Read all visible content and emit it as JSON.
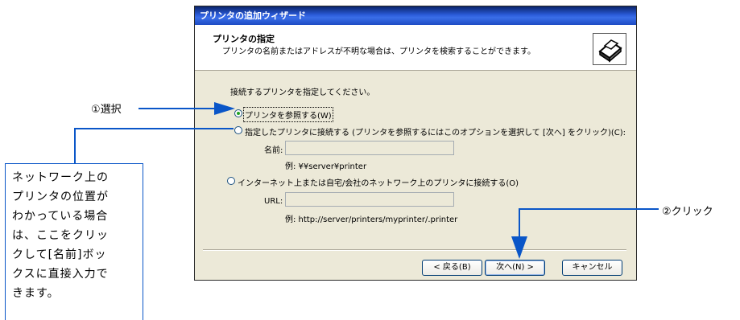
{
  "dialog": {
    "title": "プリンタの追加ウィザード",
    "header_title": "プリンタの指定",
    "header_subtitle": "プリンタの名前またはアドレスが不明な場合は、プリンタを検索することができます。",
    "prompt": "接続するプリンタを指定してください。",
    "options": [
      {
        "label": "プリンタを参照する(W)",
        "selected": true
      },
      {
        "label": "指定したプリンタに接続する (プリンタを参照するにはこのオプションを選択して [次へ] をクリック)(C):",
        "selected": false
      },
      {
        "label": "インターネット上または自宅/会社のネットワーク上のプリンタに接続する(O)",
        "selected": false
      }
    ],
    "name_field": {
      "label": "名前:",
      "value": "",
      "example": "例: ¥¥server¥printer"
    },
    "url_field": {
      "label": "URL:",
      "value": "",
      "example": "例: http://server/printers/myprinter/.printer"
    },
    "buttons": {
      "back": "< 戻る(B)",
      "next": "次へ(N) >",
      "cancel": "キャンセル"
    }
  },
  "annotations": {
    "select": "①選択",
    "click": "②クリック",
    "note": "ネットワーク上の\nプリンタの位置が\nわかっている場合\nは、ここをクリッ\nクして[名前]ボッ\nクスに直接入力で\nきます。"
  },
  "colors": {
    "arrow": "#0a56c8",
    "title_bar": "#2a5ad8",
    "dialog_bg": "#ece9d8"
  }
}
